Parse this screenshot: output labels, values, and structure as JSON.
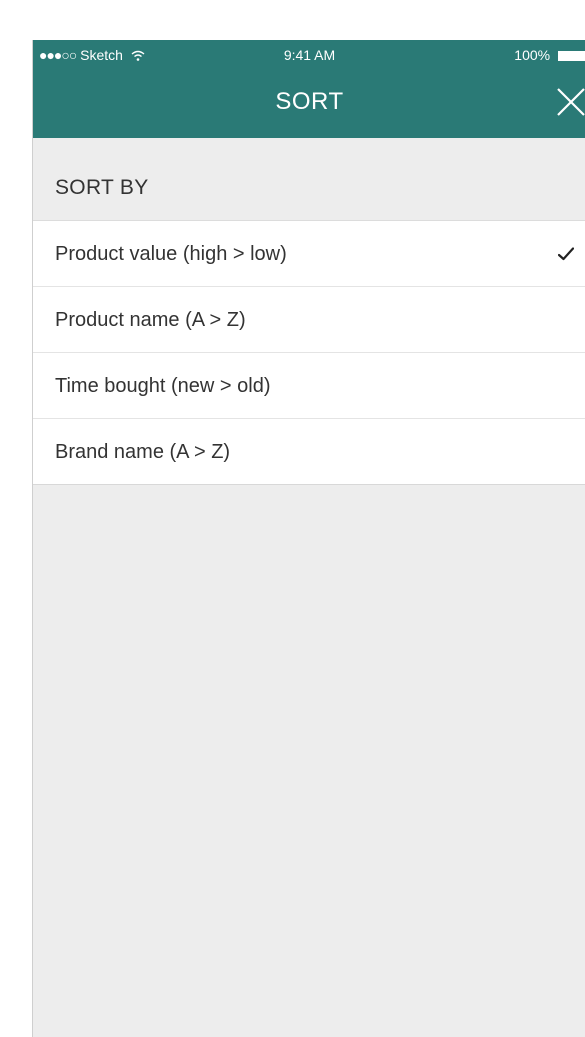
{
  "statusbar": {
    "carrier": "Sketch",
    "time": "9:41 AM",
    "battery": "100%"
  },
  "nav": {
    "title": "SORT",
    "close_icon": "close-icon"
  },
  "sort_section": {
    "heading": "SORT BY",
    "options": [
      {
        "label": "Product value (high > low)",
        "selected": true
      },
      {
        "label": "Product name (A > Z)",
        "selected": false
      },
      {
        "label": "Time bought (new > old)",
        "selected": false
      },
      {
        "label": "Brand name (A > Z)",
        "selected": false
      }
    ]
  },
  "colors": {
    "header": "#2a7a76",
    "background": "#ededed",
    "row": "#ffffff"
  }
}
